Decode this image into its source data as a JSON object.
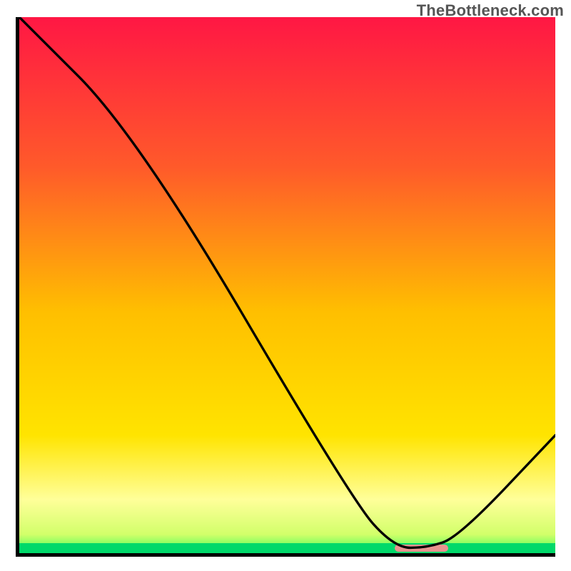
{
  "watermark": "TheBottleneck.com",
  "colors": {
    "top_red": "#ff1744",
    "mid_orange": "#ff9e00",
    "mid_yellow": "#ffe400",
    "pale_yellow": "#ffff9a",
    "near_green": "#d8ff6a",
    "green": "#00d96a",
    "curve": "#000000",
    "border": "#000000",
    "marker": "#e8938f"
  },
  "chart_data": {
    "type": "line",
    "title": "",
    "xlabel": "",
    "ylabel": "",
    "xlim": [
      0,
      100
    ],
    "ylim": [
      0,
      100
    ],
    "x": [
      0,
      22,
      62,
      70,
      76,
      82,
      100
    ],
    "values": [
      100,
      78,
      10,
      1,
      1,
      3,
      22
    ],
    "marker_x_range": [
      70,
      80
    ],
    "gradient_stops": [
      {
        "pos": 0.0,
        "color": "#ff1744"
      },
      {
        "pos": 0.28,
        "color": "#ff5a2a"
      },
      {
        "pos": 0.55,
        "color": "#ffbf00"
      },
      {
        "pos": 0.78,
        "color": "#ffe400"
      },
      {
        "pos": 0.9,
        "color": "#ffff9a"
      },
      {
        "pos": 0.965,
        "color": "#d2ff6a"
      },
      {
        "pos": 0.985,
        "color": "#7fff60"
      },
      {
        "pos": 1.0,
        "color": "#00d96a"
      }
    ]
  }
}
